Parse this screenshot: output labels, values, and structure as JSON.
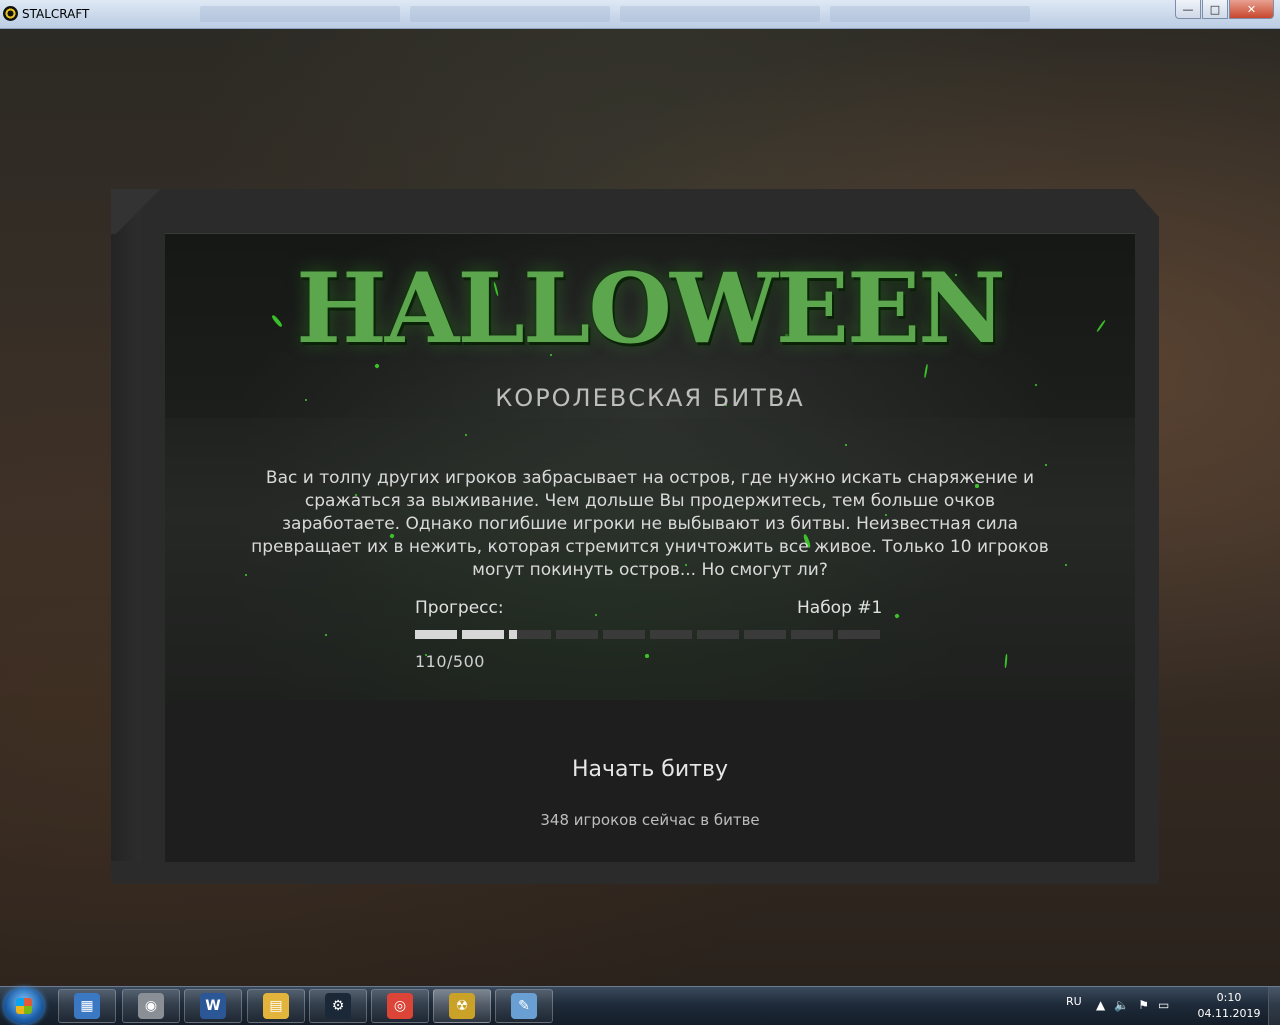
{
  "window": {
    "title": "STALCRAFT",
    "minimize": "—",
    "maximize": "□",
    "close": "✕"
  },
  "event": {
    "logo": "HALLOWEEN",
    "subtitle": "КОРОЛЕВСКАЯ БИТВА",
    "description": "Вас и толпу других игроков забрасывает на остров, где нужно искать снаряжение и сражаться за выживание. Чем дольше Вы продержитесь, тем больше очков заработаете. Однако погибшие игроки не выбывают из битвы. Неизвестная сила превращает их в нежить, которая стремится уничтожить все живое. Только 10 игроков могут покинуть остров... Но смогут ли?",
    "progress_label": "Прогресс:",
    "set_label": "Набор #1",
    "progress_current": 110,
    "progress_max": 500,
    "progress_segments": 10,
    "progress_text": "110/500",
    "start_button": "Начать битву",
    "players_online": "348 игроков сейчас в битве"
  },
  "taskbar": {
    "apps": [
      {
        "name": "calculator-icon",
        "glyph": "▦",
        "color": "#3a78c4"
      },
      {
        "name": "speaker-icon",
        "glyph": "◉",
        "color": "#8a8f96"
      },
      {
        "name": "word-icon",
        "glyph": "W",
        "color": "#2b5797"
      },
      {
        "name": "explorer-folder-icon",
        "glyph": "▤",
        "color": "#e3b43c"
      },
      {
        "name": "steam-icon",
        "glyph": "⚙",
        "color": "#1b2838"
      },
      {
        "name": "chrome-icon",
        "glyph": "◎",
        "color": "#db4437"
      },
      {
        "name": "stalcraft-icon",
        "glyph": "☢",
        "color": "#c9a227"
      },
      {
        "name": "paint-icon",
        "glyph": "✎",
        "color": "#6a9fd4"
      }
    ],
    "language": "RU",
    "time": "0:10",
    "date": "04.11.2019"
  }
}
